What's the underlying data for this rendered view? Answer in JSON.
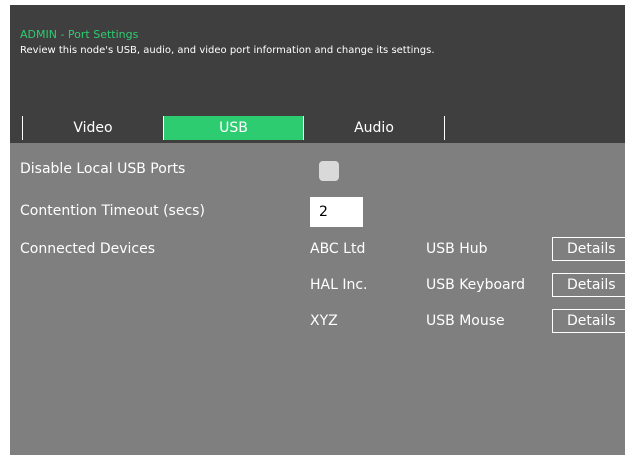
{
  "header": {
    "title": "ADMIN - Port Settings",
    "subtitle": "Review this node's USB, audio, and video port information and change its settings."
  },
  "tabs": [
    {
      "label": "Video",
      "active": false
    },
    {
      "label": "USB",
      "active": true
    },
    {
      "label": "Audio",
      "active": false
    }
  ],
  "settings": {
    "disable_local_usb_label": "Disable Local USB Ports",
    "disable_local_usb_checked": false,
    "contention_timeout_label": "Contention Timeout (secs)",
    "contention_timeout_value": "2",
    "connected_devices_label": "Connected Devices"
  },
  "devices": [
    {
      "vendor": "ABC Ltd",
      "type": "USB Hub",
      "action": "Details"
    },
    {
      "vendor": "HAL Inc.",
      "type": "USB Keyboard",
      "action": "Details"
    },
    {
      "vendor": "XYZ",
      "type": "USB Mouse",
      "action": "Details"
    }
  ],
  "colors": {
    "accent": "#2ecc71",
    "header_bg": "#3f3f3f",
    "panel_bg": "#7f7f7f"
  }
}
